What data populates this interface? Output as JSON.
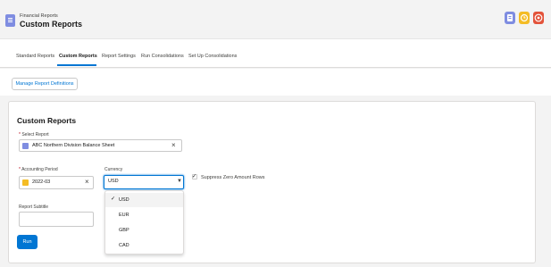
{
  "header": {
    "subtitle": "Financial Reports",
    "title": "Custom Reports",
    "actions": [
      {
        "icon": "document-icon",
        "color": "#7f8de1"
      },
      {
        "icon": "clock-icon",
        "color": "#f4bc25"
      },
      {
        "icon": "help-icon",
        "color": "#e3533b"
      }
    ]
  },
  "tabs": [
    {
      "label": "Standard Reports"
    },
    {
      "label": "Custom Reports",
      "active": true
    },
    {
      "label": "Report Settings"
    },
    {
      "label": "Run Consolidations"
    },
    {
      "label": "Set Up Consolidations"
    }
  ],
  "toolbar": {
    "manage_label": "Manage Report Definitions"
  },
  "form": {
    "title": "Custom Reports",
    "select_report": {
      "label": "Select Report",
      "value": "ABC Northern Division Balance Sheet"
    },
    "accounting_period": {
      "label": "Accounting Period",
      "value": "2022-03"
    },
    "currency": {
      "label": "Currency",
      "value": "USD",
      "options": [
        "USD",
        "EUR",
        "GBP",
        "CAD"
      ],
      "selected": "USD"
    },
    "suppress": {
      "label": "Suppress Zero Amount Rows",
      "checked": true
    },
    "subtitle": {
      "label": "Report Subtitle",
      "value": ""
    },
    "run_label": "Run"
  },
  "colors": {
    "accent": "#0176d3",
    "icon_report": "#7f8de1",
    "icon_period": "#f4bc25"
  }
}
